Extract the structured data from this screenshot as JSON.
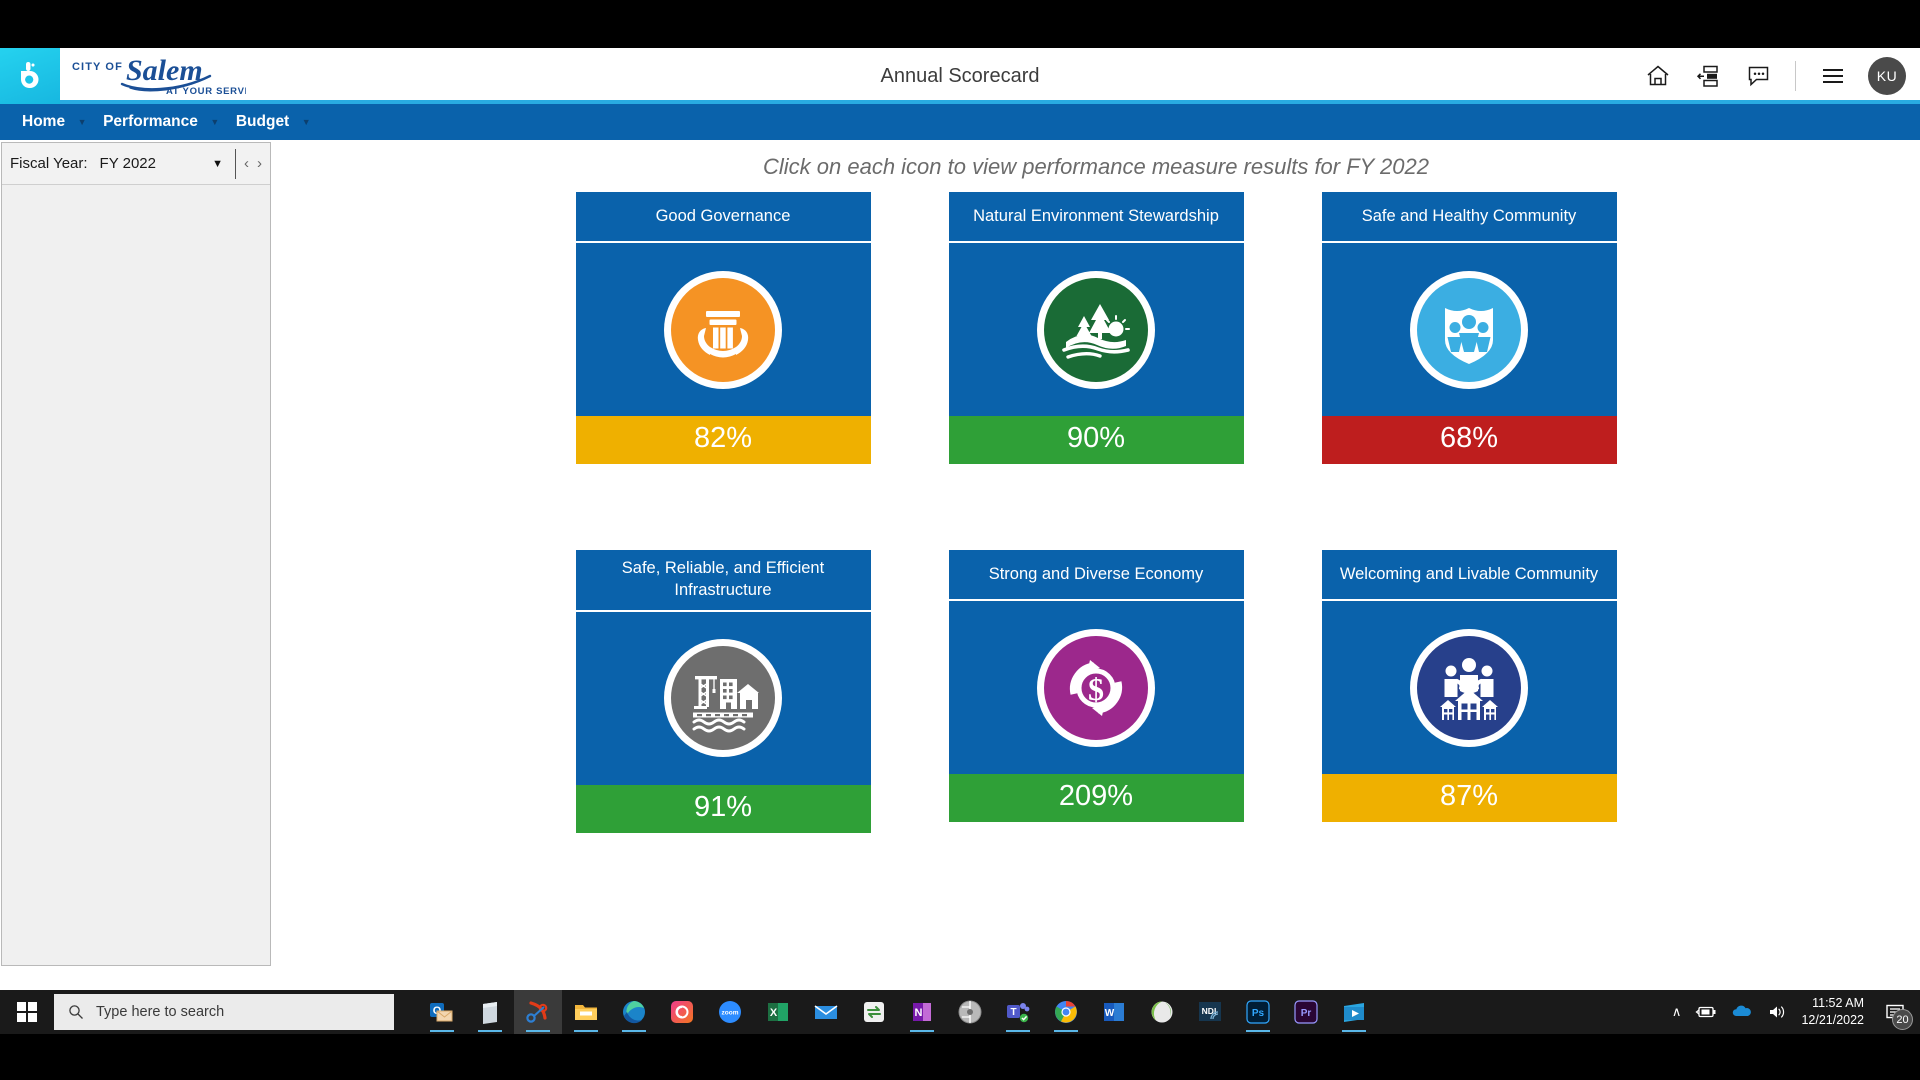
{
  "header": {
    "title": "Annual Scorecard",
    "logo_line1": "CITY OF",
    "logo_script": "Salem",
    "logo_tagline": "AT YOUR SERVICE",
    "logo_mark": "b",
    "icons": [
      {
        "name": "home-icon",
        "label": "Home"
      },
      {
        "name": "dashboard-icon",
        "label": "Dashboards"
      },
      {
        "name": "comment-icon",
        "label": "Comments"
      },
      {
        "name": "hamburger-menu-icon",
        "label": "Menu"
      }
    ],
    "avatar_initials": "KU"
  },
  "nav": {
    "items": [
      {
        "label": "Home",
        "caret": "▼"
      },
      {
        "label": "Performance",
        "caret": "▼"
      },
      {
        "label": "Budget",
        "caret": "▼"
      }
    ]
  },
  "sidebar": {
    "fiscal_year_label": "Fiscal Year:",
    "fiscal_year_value": "FY 2022",
    "dropdown_caret": "▼",
    "prev_chevron": "‹",
    "next_chevron": "›"
  },
  "main": {
    "instructions": "Click on each icon to view performance measure results for FY 2022"
  },
  "colors": {
    "card_blue": "#0A62AB",
    "nav_blue": "#0A62AB",
    "accent_cyan": "#29ABE2",
    "status_yellow": "#EFB000",
    "status_green": "#2FA037",
    "status_red": "#BE1E1E"
  },
  "cards": [
    {
      "title": "Good Governance",
      "value": "82%",
      "status_color": "#EFB000",
      "icon_name": "governance-pillar-hands-icon",
      "icon_bg": "#F59324"
    },
    {
      "title": "Natural Environment Stewardship",
      "value": "90%",
      "status_color": "#2FA037",
      "icon_name": "environment-trees-sun-icon",
      "icon_bg": "#1A6B36"
    },
    {
      "title": "Safe and Healthy Community",
      "value": "68%",
      "status_color": "#BE1E1E",
      "icon_name": "safety-shield-people-icon",
      "icon_bg": "#3BAEE2"
    },
    {
      "title": "Safe, Reliable, and Efficient Infrastructure",
      "value": "91%",
      "status_color": "#2FA037",
      "icon_name": "infrastructure-crane-bridge-icon",
      "icon_bg": "#6E6E6E"
    },
    {
      "title": "Strong and Diverse Economy",
      "value": "209%",
      "status_color": "#2FA037",
      "icon_name": "economy-dollar-cycle-icon",
      "icon_bg": "#9C288C"
    },
    {
      "title": "Welcoming and Livable Community",
      "value": "87%",
      "status_color": "#EFB000",
      "icon_name": "community-people-houses-icon",
      "icon_bg": "#27408B"
    }
  ],
  "taskbar": {
    "start_label": "Start",
    "search_placeholder": "Type here to search",
    "apps": [
      {
        "name": "outlook-icon",
        "open": true
      },
      {
        "name": "word-document-icon",
        "open": true
      },
      {
        "name": "snipping-tool-icon",
        "open": true,
        "active": true
      },
      {
        "name": "file-explorer-icon",
        "open": true
      },
      {
        "name": "microsoft-edge-icon",
        "open": true
      },
      {
        "name": "adobe-creative-cloud-icon",
        "open": false
      },
      {
        "name": "zoom-icon",
        "open": false
      },
      {
        "name": "excel-icon",
        "open": false
      },
      {
        "name": "mail-icon",
        "open": false
      },
      {
        "name": "sync-app-icon",
        "open": false
      },
      {
        "name": "onenote-icon",
        "open": true
      },
      {
        "name": "disc-icon",
        "open": false
      },
      {
        "name": "microsoft-teams-icon",
        "open": true
      },
      {
        "name": "google-chrome-icon",
        "open": true
      },
      {
        "name": "word-icon",
        "open": false
      },
      {
        "name": "globe-icon",
        "open": false
      },
      {
        "name": "ndi-icon",
        "open": false
      },
      {
        "name": "photoshop-icon",
        "open": true
      },
      {
        "name": "premiere-icon",
        "open": false
      },
      {
        "name": "video-player-icon",
        "open": true
      }
    ],
    "tray": {
      "show_hidden_chevron": "∧",
      "battery_icon": "battery-charging-icon",
      "onedrive_icon": "onedrive-icon",
      "volume_icon": "volume-icon",
      "time": "11:52 AM",
      "date": "12/21/2022",
      "notification_count": "20"
    }
  }
}
